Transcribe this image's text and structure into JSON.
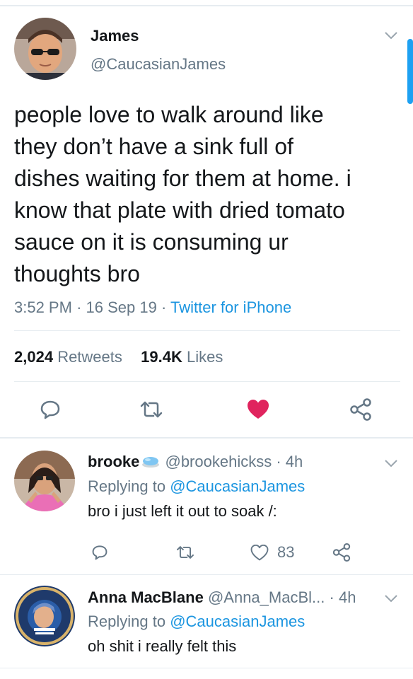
{
  "tweet": {
    "display_name": "James",
    "handle": "@CaucasianJames",
    "text_lines": [
      "people love to walk around like",
      "they don’t have a sink full of",
      "dishes waiting for them at home. i",
      "know that plate with dried tomato",
      "sauce on it is consuming ur",
      "thoughts bro"
    ],
    "time": "3:52 PM",
    "date": "16 Sep 19",
    "source": "Twitter for iPhone",
    "sep": "·",
    "retweets_count": "2,024",
    "retweets_label": "Retweets",
    "likes_count": "19.4K",
    "likes_label": "Likes",
    "liked": true
  },
  "replies": [
    {
      "display_name": "brooke",
      "emoji_name": "soap-emoji",
      "handle": "@brookehickss",
      "sep": "·",
      "age": "4h",
      "replying_prefix": "Replying to",
      "replying_to": "@CaucasianJames",
      "text": "bro i just left it out to soak /:",
      "likes": "83"
    },
    {
      "display_name": "Anna MacBlane",
      "handle": "@Anna_MacBl...",
      "sep": "·",
      "age": "4h",
      "replying_prefix": "Replying to",
      "replying_to": "@CaucasianJames",
      "text": "oh shit i really felt this"
    }
  ],
  "colors": {
    "text": "#14171a",
    "muted": "#657786",
    "link": "#1b95e0",
    "like": "#e0245e",
    "divider": "#e6ecf0"
  }
}
